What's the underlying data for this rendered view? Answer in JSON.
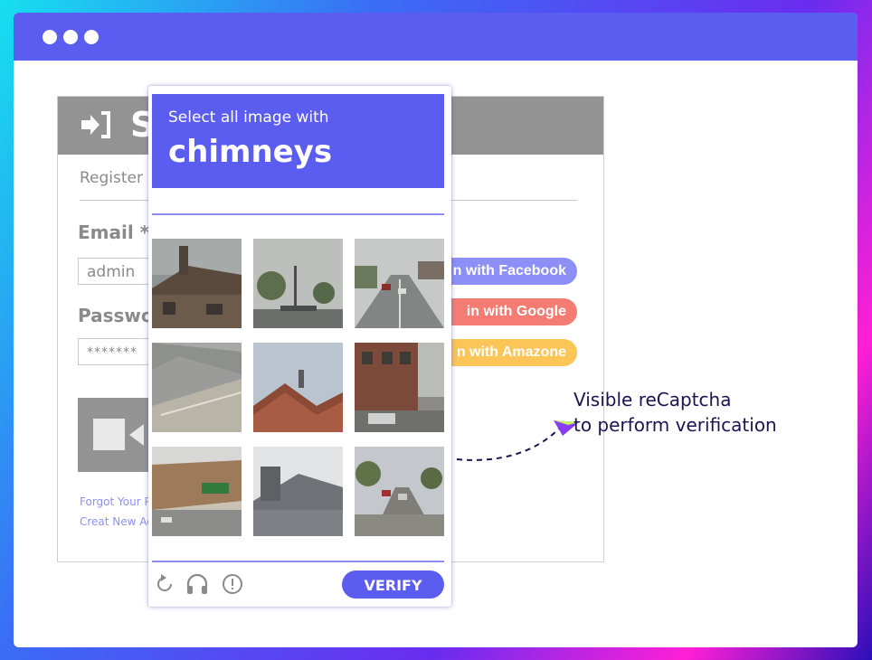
{
  "browser": {
    "window_dots": 3
  },
  "login": {
    "title": "S",
    "icon": "sign-in-icon",
    "register_link": "Register",
    "email_label": "Email *",
    "email_value": "admin",
    "password_label": "Passwo",
    "password_value": "*******",
    "social": {
      "facebook": "n with Facebook",
      "google": "in with Google",
      "amazon": "n with Amazone"
    },
    "forgot_link": "Forgot Your P",
    "create_link": "Creat New Ac"
  },
  "captcha": {
    "instruction": "Select all image with",
    "target": "chimneys",
    "tiles": [
      "house-with-chimney",
      "street-trees",
      "road-traffic",
      "highway-lanes",
      "house-roof",
      "street-corner-building",
      "highway-signs",
      "house-with-chimney-2",
      "suburban-street"
    ],
    "footer_icons": [
      "reload-icon",
      "headphones-icon",
      "info-icon"
    ],
    "verify_label": "VERIFY"
  },
  "annotation": {
    "line1": "Visible reCaptcha",
    "line2": "to perform verification"
  },
  "colors": {
    "accent": "#5b5cf0",
    "facebook": "#8d8ff6",
    "google": "#f47c73",
    "amazon": "#fbc557",
    "annotation_text": "#1c1450"
  }
}
